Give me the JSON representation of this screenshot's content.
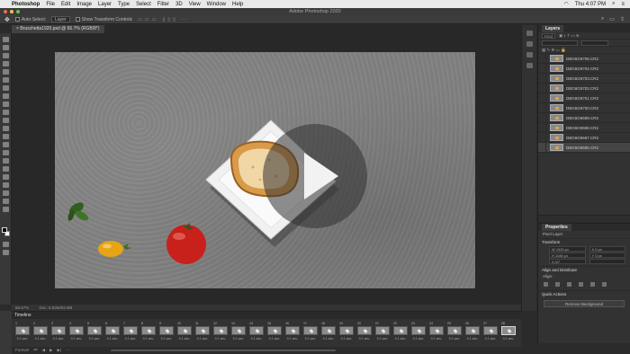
{
  "menubar": {
    "app": "Photoshop",
    "items": [
      "File",
      "Edit",
      "Image",
      "Layer",
      "Type",
      "Select",
      "Filter",
      "3D",
      "View",
      "Window",
      "Help"
    ],
    "clock": "Thu 4:07 PM"
  },
  "window": {
    "title": "Adobe Photoshop 2020"
  },
  "options": {
    "auto_select_label": "Auto-Select:",
    "auto_select_value": "Layer",
    "transform_label": "Show Transform Controls"
  },
  "document": {
    "tab_label": "Bruschetta1920.psd @ 66.7% (RGB/8*)",
    "zoom": "66.67%",
    "doc_info": "Doc: 5.93M/52.8M"
  },
  "layers": {
    "tab": "Layers",
    "kind_label": "Kind",
    "rows": [
      "DBG6G9705.CR2",
      "DBG6G9704.CR2",
      "DBG6G9703.CR2",
      "DBG6G9702.CR2",
      "DBG6G9701.CR2",
      "DBG6G9700.CR2",
      "DBG6G9699.CR2",
      "DBG6G9698.CR2",
      "DBG6G9697.CR2",
      "DBG6G9696.CR2"
    ]
  },
  "properties": {
    "tab": "Properties",
    "subtitle": "Pixel Layer",
    "transform": "Transform",
    "fields": [
      "W 1920 px",
      "X 0 px",
      "H 1080 px",
      "Y 0 px",
      "0.00°",
      ""
    ],
    "align": "Align and Distribute",
    "align_sub": "Align:",
    "quick": "Quick Actions",
    "remove_bg": "Remove Background"
  },
  "timeline": {
    "title": "Timeline",
    "frames": [
      {
        "num": "1",
        "dur": "0.1 sec."
      },
      {
        "num": "2",
        "dur": "0.1 sec."
      },
      {
        "num": "3",
        "dur": "0.1 sec."
      },
      {
        "num": "4",
        "dur": "0.1 sec."
      },
      {
        "num": "5",
        "dur": "0.1 sec."
      },
      {
        "num": "6",
        "dur": "0.1 sec."
      },
      {
        "num": "7",
        "dur": "0.1 sec."
      },
      {
        "num": "8",
        "dur": "0.1 sec."
      },
      {
        "num": "9",
        "dur": "0.1 sec."
      },
      {
        "num": "10",
        "dur": "0.1 sec."
      },
      {
        "num": "11",
        "dur": "0.1 sec."
      },
      {
        "num": "12",
        "dur": "0.1 sec."
      },
      {
        "num": "13",
        "dur": "0.1 sec."
      },
      {
        "num": "14",
        "dur": "0.1 sec."
      },
      {
        "num": "15",
        "dur": "0.1 sec."
      },
      {
        "num": "16",
        "dur": "0.1 sec."
      },
      {
        "num": "17",
        "dur": "0.1 sec."
      },
      {
        "num": "18",
        "dur": "0.1 sec."
      },
      {
        "num": "19",
        "dur": "0.1 sec."
      },
      {
        "num": "20",
        "dur": "0.1 sec."
      },
      {
        "num": "21",
        "dur": "0.1 sec."
      },
      {
        "num": "22",
        "dur": "0.1 sec."
      },
      {
        "num": "23",
        "dur": "0.1 sec."
      },
      {
        "num": "24",
        "dur": "0.1 sec."
      },
      {
        "num": "25",
        "dur": "0.1 sec."
      },
      {
        "num": "26",
        "dur": "0.1 sec."
      },
      {
        "num": "27",
        "dur": "0.1 sec."
      },
      {
        "num": "28",
        "dur": "0.1 sec."
      }
    ],
    "loop": "Forever"
  },
  "icons": {
    "play": "play-icon",
    "move": "move-tool-icon"
  },
  "colors": {
    "accent": "#c8e6ff",
    "canvas_bg": "#808080"
  }
}
